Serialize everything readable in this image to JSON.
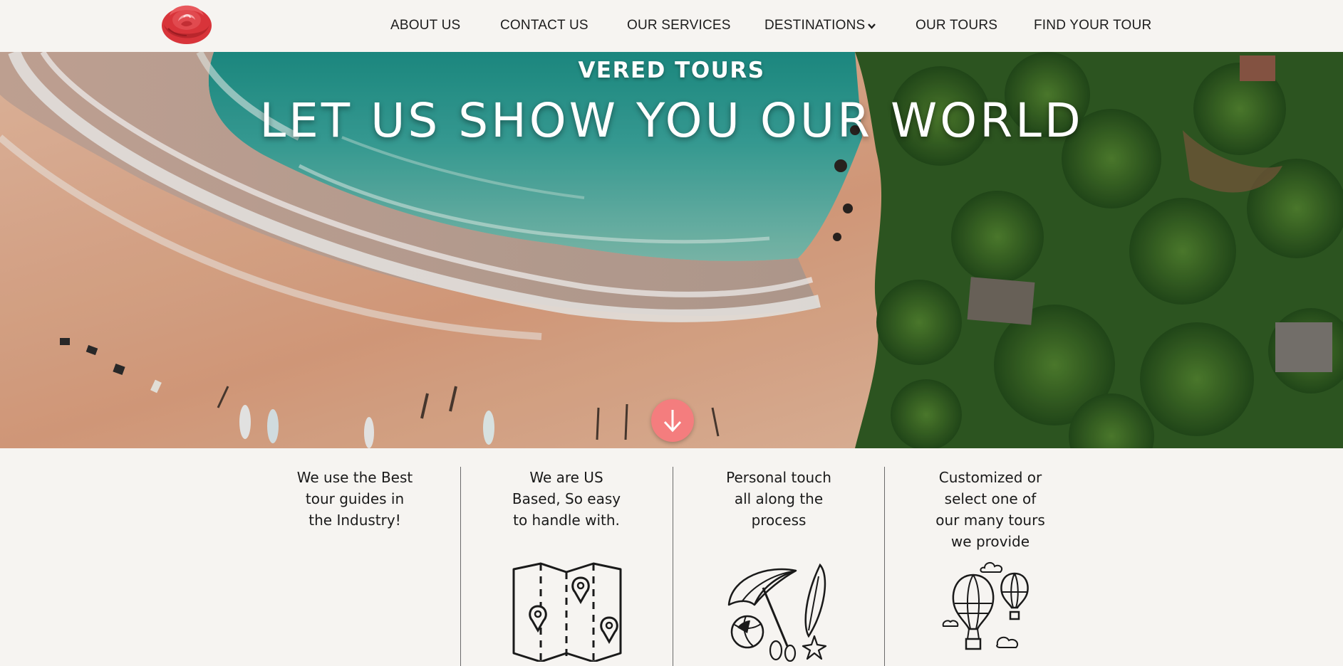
{
  "header": {
    "logo_icon": "rose-icon",
    "nav": [
      {
        "label": "ABOUT US"
      },
      {
        "label": "CONTACT US"
      },
      {
        "label": "OUR SERVICES"
      },
      {
        "label": "DESTINATIONS",
        "has_dropdown": true
      },
      {
        "label": "OUR TOURS"
      },
      {
        "label": "FIND YOUR TOUR"
      }
    ]
  },
  "hero": {
    "brand": "VERED TOURS",
    "title": "LET US SHOW YOU OUR WORLD",
    "scroll_icon": "arrow-down-icon",
    "accent_color": "#f47d7e"
  },
  "features": [
    {
      "lines": [
        "We use the Best",
        "tour guides in",
        "the Industry!"
      ],
      "icon": ""
    },
    {
      "lines": [
        "We are US",
        "Based, So easy",
        "to handle with."
      ],
      "icon": "map-pins-icon"
    },
    {
      "lines": [
        "Personal touch",
        "all along the",
        "process"
      ],
      "icon": "beach-icon"
    },
    {
      "lines": [
        "Customized or",
        "select one of",
        "our many tours",
        "we provide"
      ],
      "icon": "hot-air-balloons-icon"
    }
  ]
}
